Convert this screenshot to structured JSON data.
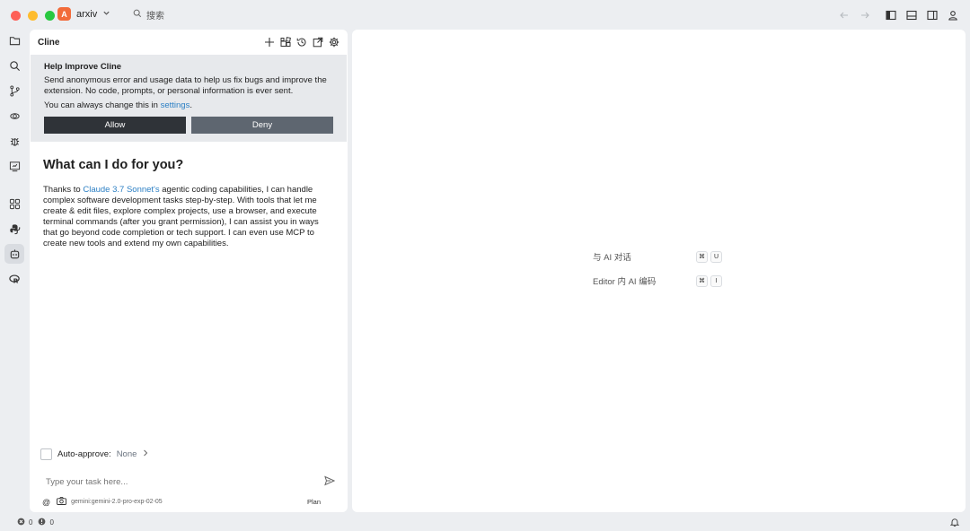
{
  "window": {
    "traffic_colors": [
      "#fe5f57",
      "#febc2e",
      "#28c840"
    ],
    "project_badge": "A",
    "project_name": "arxiv",
    "search_placeholder": "搜索"
  },
  "activity_bar": {
    "icons": [
      "folder-icon",
      "search-icon",
      "source-control-icon",
      "remote-icon",
      "debug-icon",
      "preview-icon",
      "extensions-icon",
      "python-icon",
      "cline-icon",
      "r-icon"
    ],
    "active": "cline-icon"
  },
  "cline": {
    "title": "Cline",
    "help": {
      "title": "Help Improve Cline",
      "text": "Send anonymous error and usage data to help us fix bugs and improve the extension. No code, prompts, or personal information is ever sent.",
      "change_prefix": "You can always change this in ",
      "settings_link": "settings",
      "change_suffix": ".",
      "allow_label": "Allow",
      "deny_label": "Deny"
    },
    "welcome": {
      "heading": "What can I do for you?",
      "text_prefix": "Thanks to ",
      "model_link": "Claude 3.7 Sonnet's",
      "text_suffix": " agentic coding capabilities, I can handle complex software development tasks step-by-step. With tools that let me create & edit files, explore complex projects, use a browser, and execute terminal commands (after you grant permission), I can assist you in ways that go beyond code completion or tech support. I can even use MCP to create new tools and extend my own capabilities."
    },
    "auto_approve_label": "Auto-approve:",
    "auto_approve_value": "None",
    "task_placeholder": "Type your task here...",
    "model_id": "gemini:gemini-2.0-pro-exp-02-05",
    "mode": "Plan"
  },
  "editor": {
    "shortcuts": [
      {
        "label": "与 AI 对话",
        "keys": [
          "⌘",
          "U"
        ]
      },
      {
        "label": "Editor 内 AI 编码",
        "keys": [
          "⌘",
          "I"
        ]
      }
    ]
  },
  "status_bar": {
    "errors": "0",
    "warnings": "0"
  }
}
